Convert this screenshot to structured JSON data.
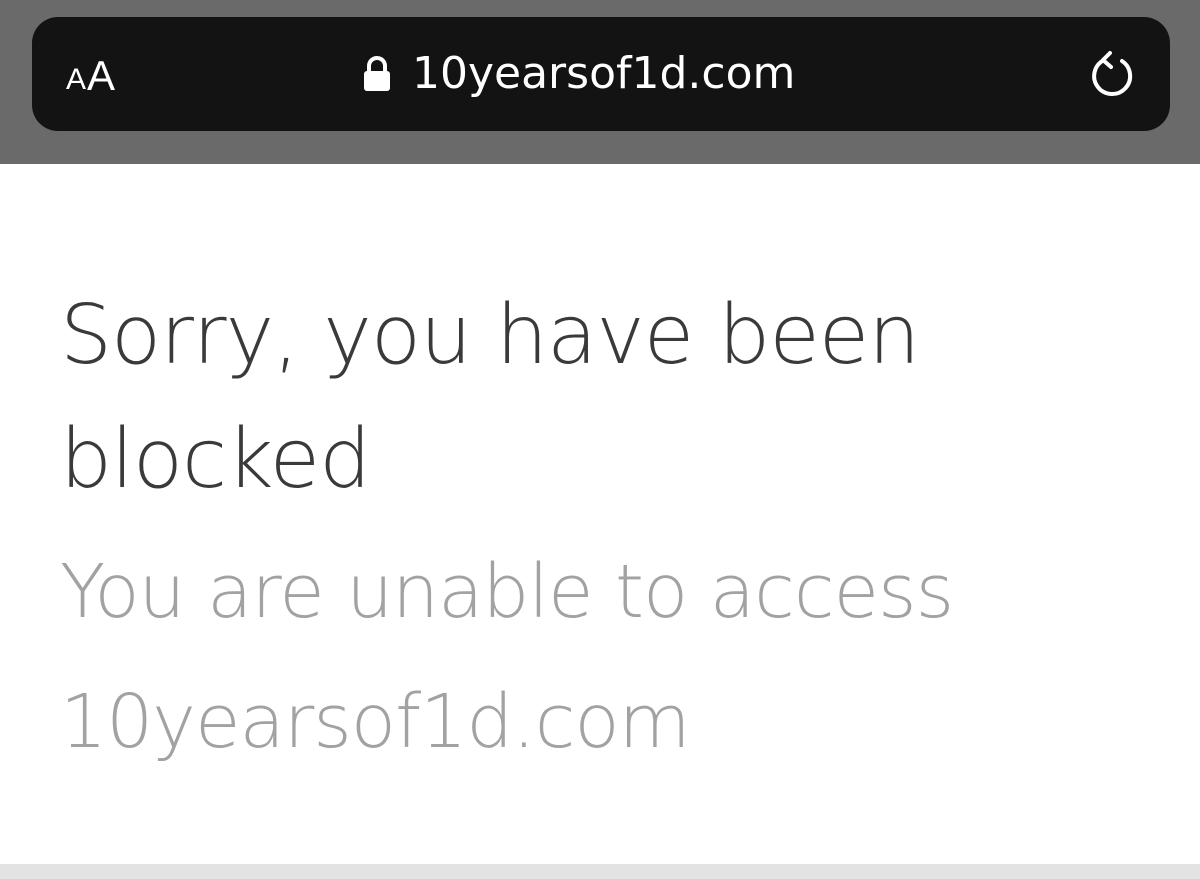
{
  "browser": {
    "text_size_small": "A",
    "text_size_large": "A",
    "url": "10yearsof1d.com",
    "lock_icon": "lock-icon",
    "reload_icon": "reload-icon"
  },
  "page": {
    "heading": "Sorry, you have been blocked",
    "subheading": "You are unable to access 10yearsof1d.com"
  },
  "colors": {
    "chrome_background": "#6a6a6a",
    "address_bar_background": "#131313",
    "heading_text": "#3a3a3a",
    "subheading_text": "#a2a2a2"
  }
}
